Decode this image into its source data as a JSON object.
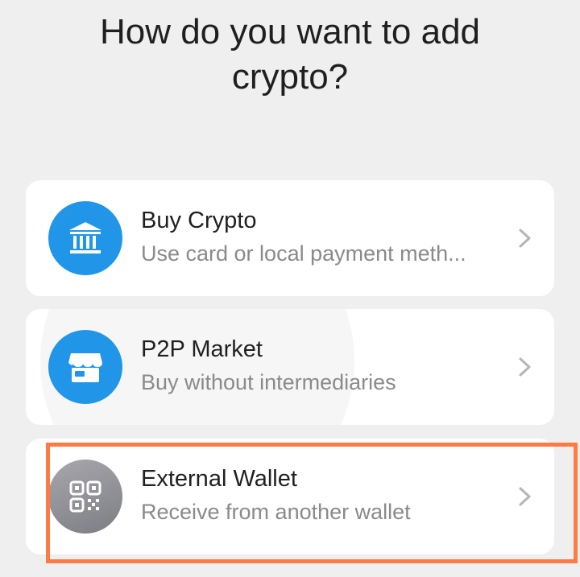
{
  "page": {
    "title": "How do you want to add crypto?"
  },
  "options": [
    {
      "title": "Buy Crypto",
      "subtitle": "Use card or local payment meth...",
      "icon": "bank-icon",
      "icon_bg": "#2196e8"
    },
    {
      "title": "P2P Market",
      "subtitle": "Buy without intermediaries",
      "icon": "storefront-icon",
      "icon_bg": "#2196e8"
    },
    {
      "title": "External Wallet",
      "subtitle": "Receive from another wallet",
      "icon": "qr-code-icon",
      "icon_bg": "#8e8e94"
    }
  ],
  "highlight_color": "#ff7a45"
}
